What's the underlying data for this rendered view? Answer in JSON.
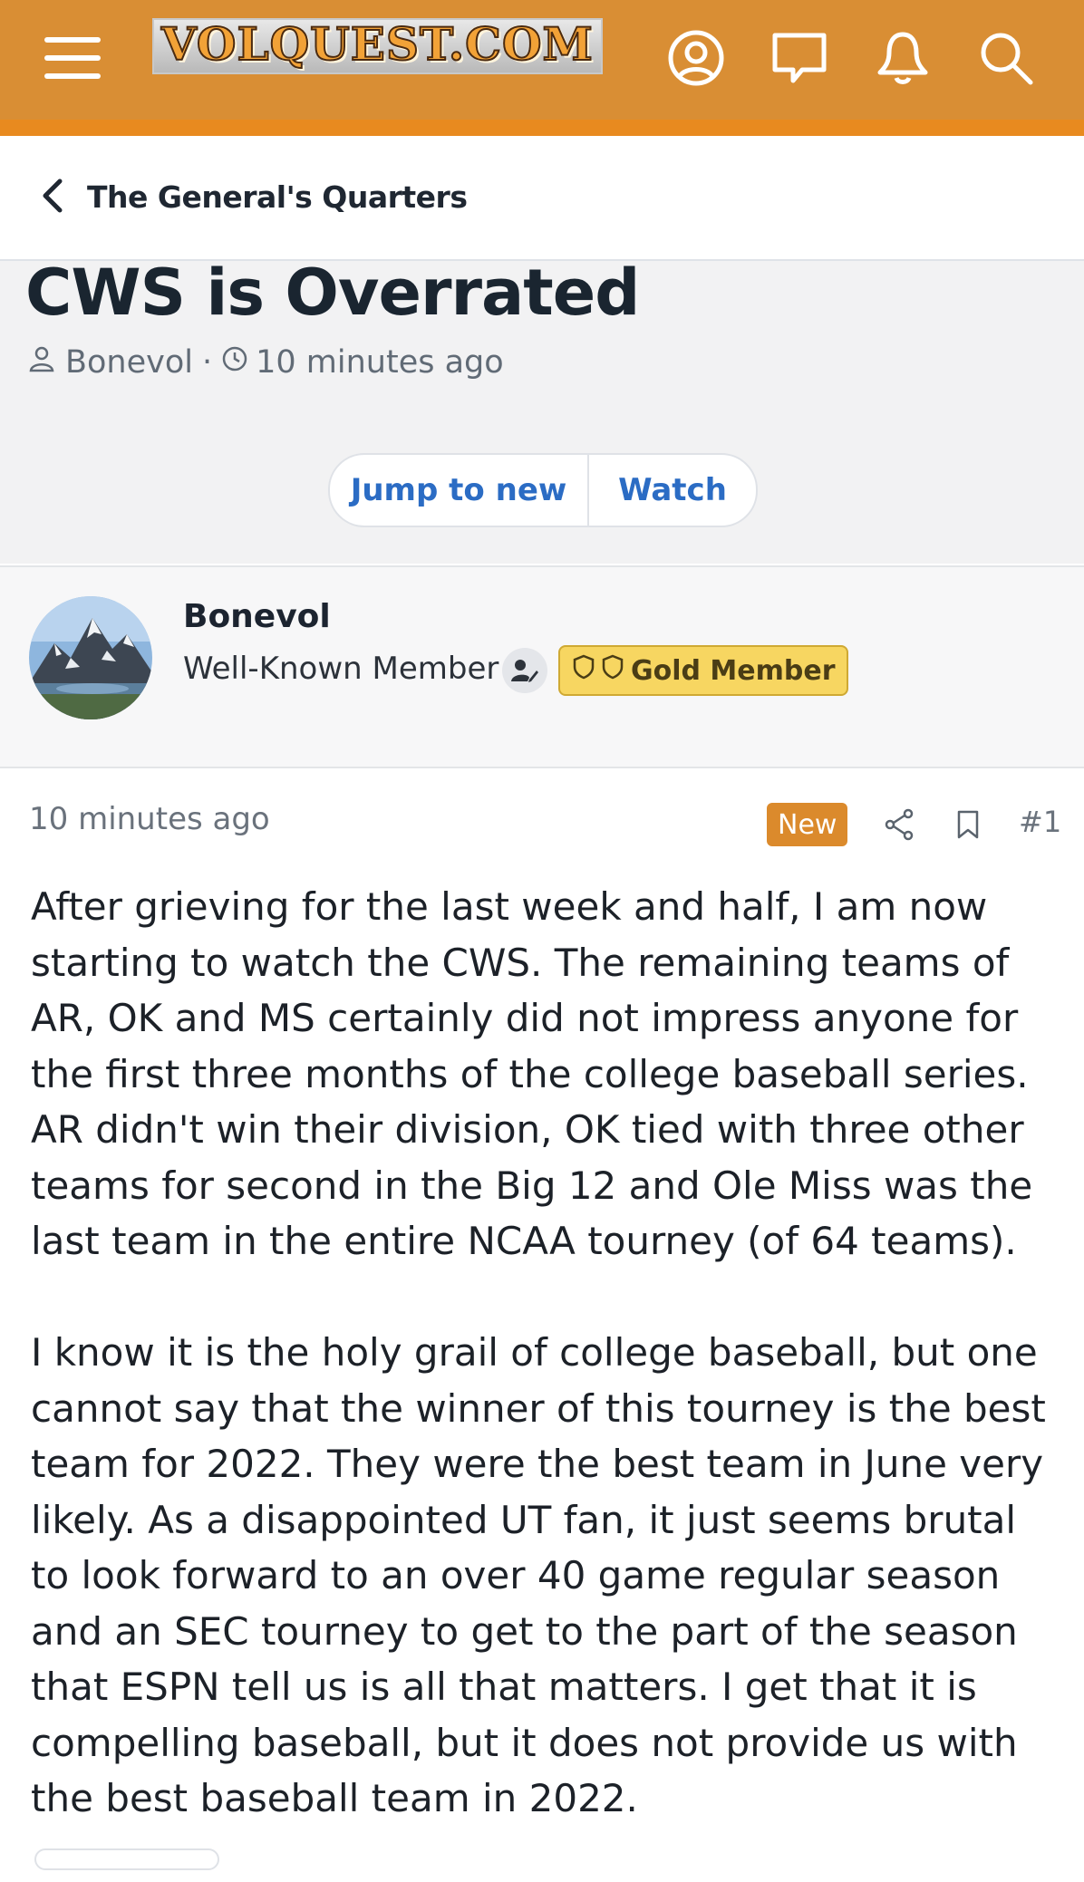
{
  "header": {
    "logo_text": "VOLQUEST.COM",
    "icons": [
      "menu-icon",
      "account-icon",
      "conversations-icon",
      "alerts-icon",
      "search-icon"
    ],
    "colors": {
      "bar": "#d98e34",
      "accent_strip": "#e88a1f"
    }
  },
  "breadcrumb": {
    "label": "The General's Quarters"
  },
  "thread": {
    "title": "CWS is Overrated",
    "author": "Bonevol",
    "separator": "·",
    "time": "10 minutes ago",
    "actions": {
      "jump_to_new": "Jump to new",
      "watch": "Watch"
    }
  },
  "author_card": {
    "name": "Bonevol",
    "title": "Well-Known Member",
    "badge": "Gold Member",
    "badge_color": "#f7d661"
  },
  "post": {
    "time": "10 minutes ago",
    "new_label": "New",
    "number": "#1",
    "paragraphs": [
      "After grieving for the last week and half, I am now starting to watch the CWS. The remaining teams of AR, OK and MS certainly did not impress anyone for the first three months of the college baseball series. AR didn't win their division, OK tied with three other teams for second in the Big 12 and Ole Miss was the last team in the entire NCAA tourney (of 64 teams).",
      "I know it is the holy grail of college baseball, but one cannot say that the winner of this tourney is the best team for 2022. They were the best team in June very likely. As a disappointed UT fan, it just seems brutal to look forward to an over 40 game regular season and an SEC tourney to get to the part of the season that ESPN tell us is all that matters. I get that it is compelling baseball, but it does not provide us with the best baseball team in 2022."
    ]
  }
}
